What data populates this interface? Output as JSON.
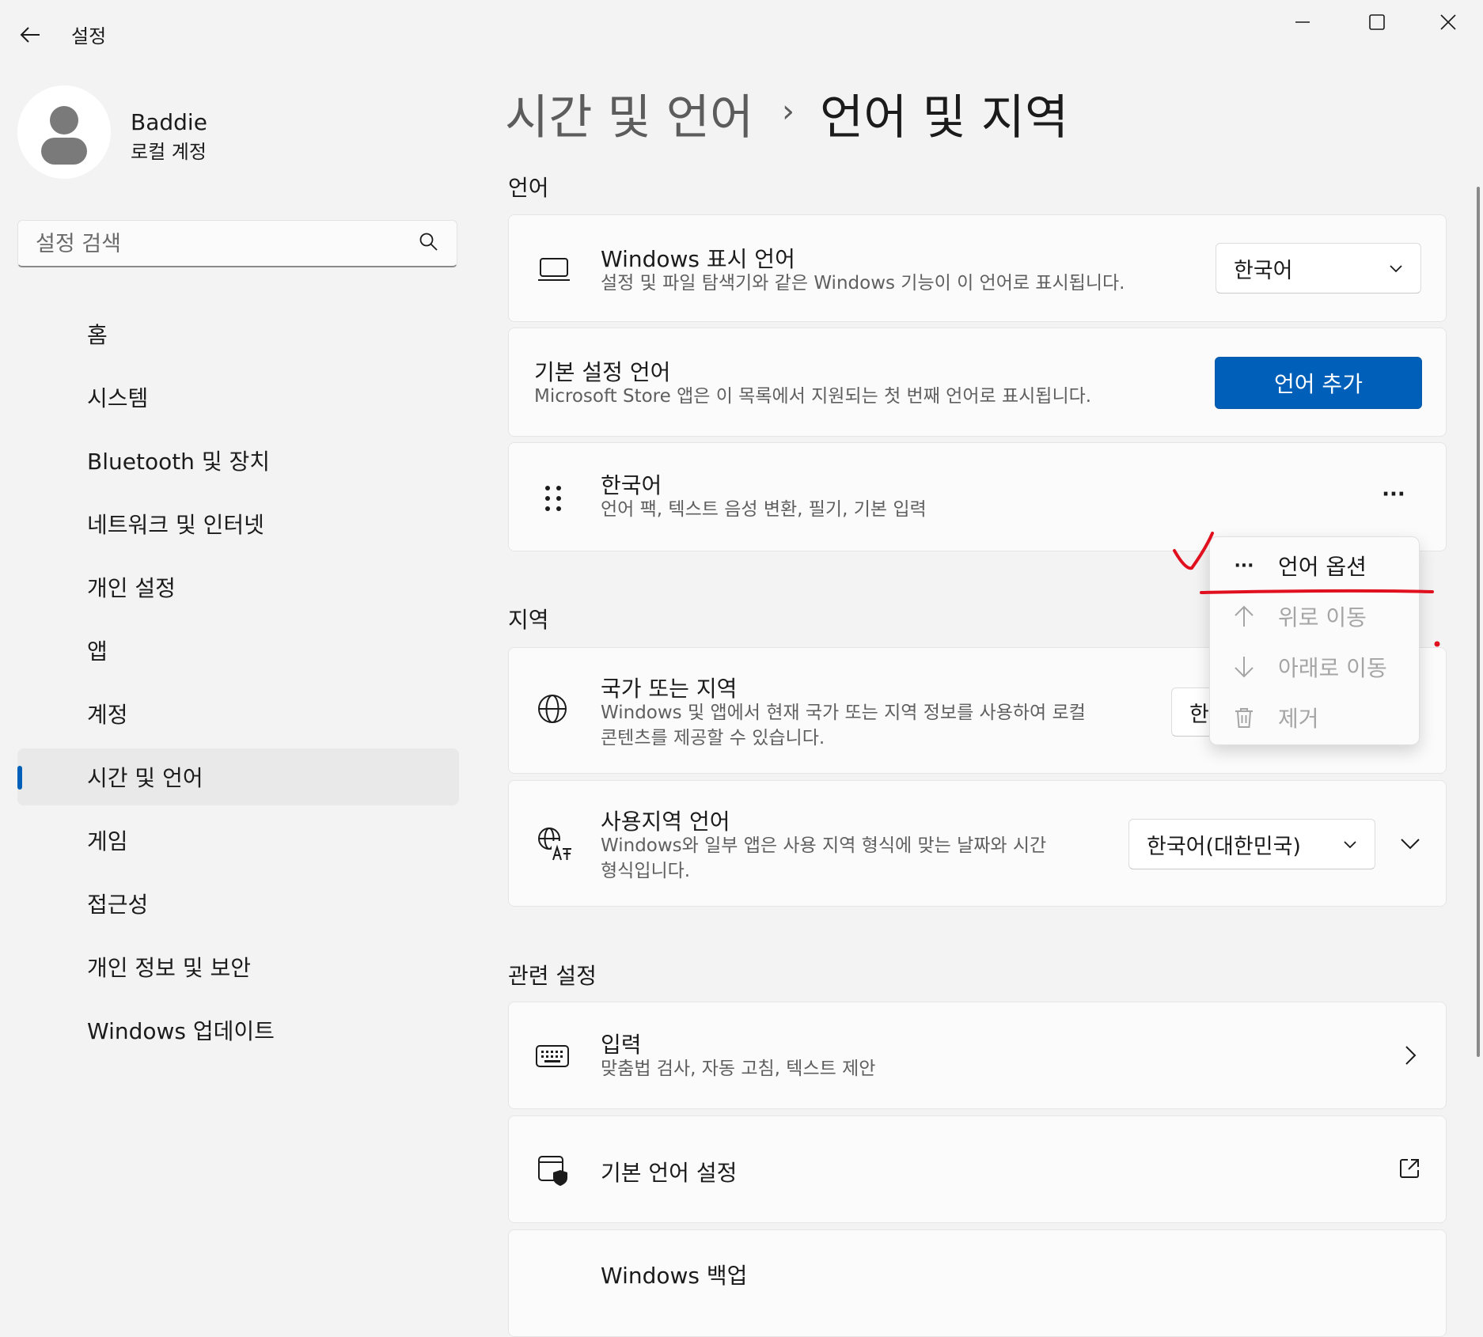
{
  "window": {
    "app_title": "설정"
  },
  "user": {
    "name": "Baddie",
    "account_type": "로컬 계정"
  },
  "search": {
    "placeholder": "설정 검색"
  },
  "nav": {
    "items": [
      {
        "label": "홈",
        "icon": "home-icon"
      },
      {
        "label": "시스템",
        "icon": "system-icon"
      },
      {
        "label": "Bluetooth 및 장치",
        "icon": "bluetooth-icon"
      },
      {
        "label": "네트워크 및 인터넷",
        "icon": "network-icon"
      },
      {
        "label": "개인 설정",
        "icon": "personalization-icon"
      },
      {
        "label": "앱",
        "icon": "apps-icon"
      },
      {
        "label": "계정",
        "icon": "accounts-icon"
      },
      {
        "label": "시간 및 언어",
        "icon": "time-language-icon",
        "active": true
      },
      {
        "label": "게임",
        "icon": "gaming-icon"
      },
      {
        "label": "접근성",
        "icon": "accessibility-icon"
      },
      {
        "label": "개인 정보 및 보안",
        "icon": "privacy-icon"
      },
      {
        "label": "Windows 업데이트",
        "icon": "update-icon"
      }
    ]
  },
  "breadcrumb": {
    "parent": "시간 및 언어",
    "separator": "›",
    "current": "언어 및 지역"
  },
  "language_section": {
    "title": "언어",
    "display_language": {
      "title": "Windows 표시 언어",
      "description": "설정 및 파일 탐색기와 같은 Windows 기능이 이 언어로 표시됩니다.",
      "value": "한국어"
    },
    "preferred_languages": {
      "title": "기본 설정 언어",
      "description": "Microsoft Store 앱은 이 목록에서 지원되는 첫 번째 언어로 표시됩니다.",
      "add_button": "언어 추가"
    },
    "language_entry": {
      "title": "한국어",
      "description": "언어 팩, 텍스트 음성 변환, 필기, 기본 입력",
      "more_label": "···"
    }
  },
  "context_menu": {
    "items": [
      {
        "label": "언어 옵션",
        "icon": "more-icon",
        "enabled": true
      },
      {
        "label": "위로 이동",
        "icon": "arrow-up-icon",
        "enabled": false
      },
      {
        "label": "아래로 이동",
        "icon": "arrow-down-icon",
        "enabled": false
      },
      {
        "label": "제거",
        "icon": "trash-icon",
        "enabled": false
      }
    ]
  },
  "region_section": {
    "title": "지역",
    "country": {
      "title": "국가 또는 지역",
      "description_line1": "Windows 및 앱에서 현재 국가 또는 지역 정보를 사용하여 로컬",
      "description_line2": "콘텐츠를 제공할 수 있습니다.",
      "value_visible": "한"
    },
    "regional_format": {
      "title": "사용지역 언어",
      "description_line1": "Windows와 일부 앱은 사용 지역 형식에 맞는 날짜와 시간",
      "description_line2": "형식입니다.",
      "value": "한국어(대한민국)"
    }
  },
  "related_section": {
    "title": "관련 설정",
    "typing": {
      "title": "입력",
      "description": "맞춤법 검사, 자동 고침, 텍스트 제안"
    },
    "admin_language": {
      "title": "기본 언어 설정"
    },
    "backup": {
      "title": "Windows 백업"
    }
  },
  "colors": {
    "accent": "#005fb8",
    "annotation": "#e0101e",
    "background": "#f3f3f3",
    "card": "#fbfbfb"
  }
}
